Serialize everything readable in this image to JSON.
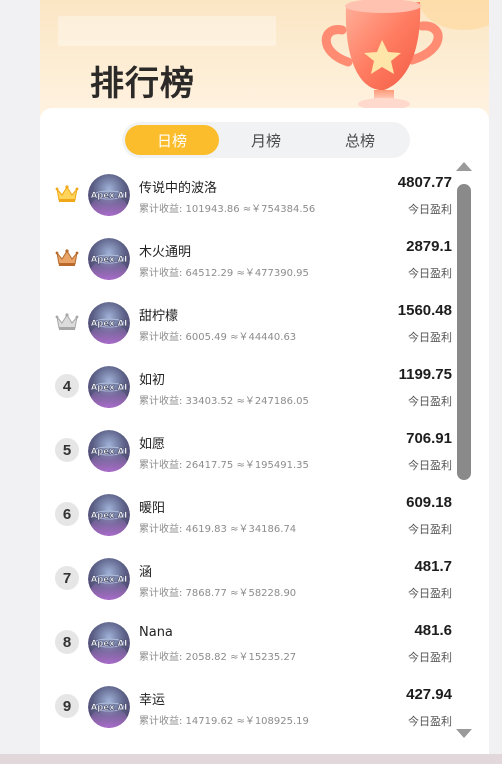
{
  "header": {
    "title": "排行榜"
  },
  "tabs": [
    {
      "label": "日榜",
      "active": true
    },
    {
      "label": "月榜",
      "active": false
    },
    {
      "label": "总榜",
      "active": false
    }
  ],
  "avatar_text": "Apex AI",
  "colors": {
    "accent": "#fbbd2b",
    "gold_crown": "#f3b21f",
    "bronze_crown": "#c8813b",
    "silver_crown": "#b9b9b9"
  },
  "ranking": [
    {
      "rank": "1",
      "crown": "gold",
      "name": "传说中的波洛",
      "earnings": "累计收益: 101943.86 ≈￥754384.56",
      "profit": "4807.77",
      "profit_label": "今日盈利"
    },
    {
      "rank": "2",
      "crown": "bronze",
      "name": "木火通明",
      "earnings": "累计收益: 64512.29 ≈￥477390.95",
      "profit": "2879.1",
      "profit_label": "今日盈利"
    },
    {
      "rank": "3",
      "crown": "silver",
      "name": "甜柠檬",
      "earnings": "累计收益: 6005.49 ≈￥44440.63",
      "profit": "1560.48",
      "profit_label": "今日盈利"
    },
    {
      "rank": "4",
      "crown": "",
      "name": "如初",
      "earnings": "累计收益: 33403.52 ≈￥247186.05",
      "profit": "1199.75",
      "profit_label": "今日盈利"
    },
    {
      "rank": "5",
      "crown": "",
      "name": "如愿",
      "earnings": "累计收益: 26417.75 ≈￥195491.35",
      "profit": "706.91",
      "profit_label": "今日盈利"
    },
    {
      "rank": "6",
      "crown": "",
      "name": "暖阳",
      "earnings": "累计收益: 4619.83 ≈￥34186.74",
      "profit": "609.18",
      "profit_label": "今日盈利"
    },
    {
      "rank": "7",
      "crown": "",
      "name": "涵",
      "earnings": "累计收益: 7868.77 ≈￥58228.90",
      "profit": "481.7",
      "profit_label": "今日盈利"
    },
    {
      "rank": "8",
      "crown": "",
      "name": "Nana",
      "earnings": "累计收益: 2058.82 ≈￥15235.27",
      "profit": "481.6",
      "profit_label": "今日盈利"
    },
    {
      "rank": "9",
      "crown": "",
      "name": "幸运",
      "earnings": "累计收益: 14719.62 ≈￥108925.19",
      "profit": "427.94",
      "profit_label": "今日盈利"
    }
  ]
}
